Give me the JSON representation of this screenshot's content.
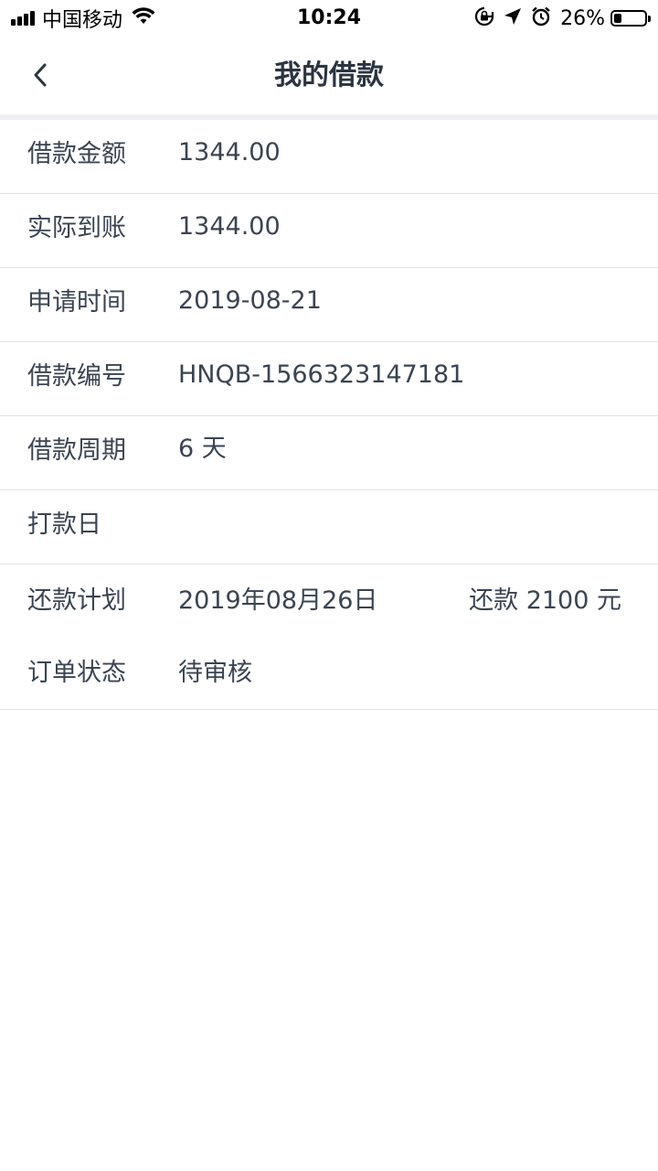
{
  "status_bar": {
    "carrier": "中国移动",
    "time": "10:24",
    "battery_percent": "26%",
    "battery_level": 0.26
  },
  "nav": {
    "title": "我的借款"
  },
  "details": {
    "amount_label": "借款金额",
    "amount_value": "1344.00",
    "received_label": "实际到账",
    "received_value": "1344.00",
    "apply_time_label": "申请时间",
    "apply_time_value": "2019-08-21",
    "loan_no_label": "借款编号",
    "loan_no_value": "HNQB-1566323147181",
    "period_label": "借款周期",
    "period_value": "6 天",
    "payout_day_label": "打款日",
    "payout_day_value": "",
    "repay_plan_label": "还款计划",
    "repay_plan_date": "2019年08月26日",
    "repay_plan_amount": "还款 2100 元",
    "order_status_label": "订单状态",
    "order_status_value": "待审核"
  },
  "colors": {
    "text": "#2b3441",
    "divider": "#e3e3e6",
    "section_gap": "#efeff1"
  }
}
